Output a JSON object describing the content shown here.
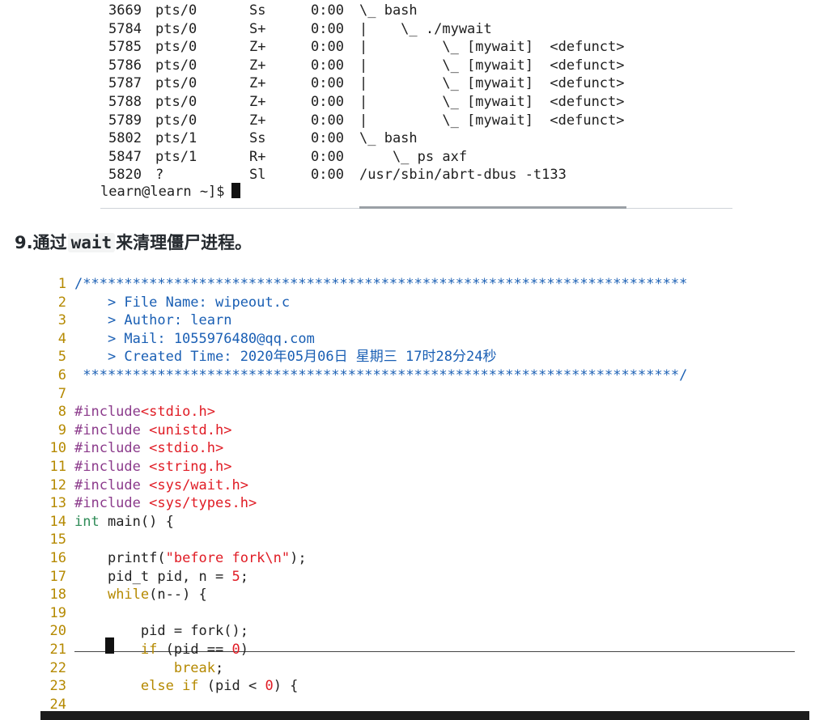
{
  "terminal": {
    "rows": [
      {
        "pid": "3669",
        "tty": "pts/0",
        "stat": "Ss",
        "time": "0:00",
        "cmd": "\\_ bash"
      },
      {
        "pid": "5784",
        "tty": "pts/0",
        "stat": "S+",
        "time": "0:00",
        "cmd": "|    \\_ ./mywait"
      },
      {
        "pid": "5785",
        "tty": "pts/0",
        "stat": "Z+",
        "time": "0:00",
        "cmd": "|         \\_ [mywait]  <defunct>"
      },
      {
        "pid": "5786",
        "tty": "pts/0",
        "stat": "Z+",
        "time": "0:00",
        "cmd": "|         \\_ [mywait]  <defunct>"
      },
      {
        "pid": "5787",
        "tty": "pts/0",
        "stat": "Z+",
        "time": "0:00",
        "cmd": "|         \\_ [mywait]  <defunct>"
      },
      {
        "pid": "5788",
        "tty": "pts/0",
        "stat": "Z+",
        "time": "0:00",
        "cmd": "|         \\_ [mywait]  <defunct>"
      },
      {
        "pid": "5789",
        "tty": "pts/0",
        "stat": "Z+",
        "time": "0:00",
        "cmd": "|         \\_ [mywait]  <defunct>"
      },
      {
        "pid": "5802",
        "tty": "pts/1",
        "stat": "Ss",
        "time": "0:00",
        "cmd": "\\_ bash"
      },
      {
        "pid": "5847",
        "tty": "pts/1",
        "stat": "R+",
        "time": "0:00",
        "cmd": "    \\_ ps axf"
      },
      {
        "pid": "5820",
        "tty": "?",
        "stat": "Sl",
        "time": "0:00",
        "cmd": "/usr/sbin/abrt-dbus -t133"
      }
    ],
    "prompt": "learn@learn ~]$"
  },
  "heading": {
    "prefix": "9.通过",
    "code": "wait",
    "suffix": "来清理僵尸进程。"
  },
  "editor": {
    "lines": [
      {
        "n": "1",
        "parts": [
          {
            "c": "t-comment",
            "t": "/*************************************************************************"
          }
        ]
      },
      {
        "n": "2",
        "parts": [
          {
            "c": "t-comment",
            "t": "    > File Name: wipeout.c"
          }
        ]
      },
      {
        "n": "3",
        "parts": [
          {
            "c": "t-comment",
            "t": "    > Author: learn"
          }
        ]
      },
      {
        "n": "4",
        "parts": [
          {
            "c": "t-comment",
            "t": "    > Mail: 1055976480@qq.com"
          }
        ]
      },
      {
        "n": "5",
        "parts": [
          {
            "c": "t-comment",
            "t": "    > Created Time: 2020年05月06日 星期三 17时28分24秒"
          }
        ]
      },
      {
        "n": "6",
        "parts": [
          {
            "c": "t-comment",
            "t": " ************************************************************************/"
          }
        ]
      },
      {
        "n": "7",
        "parts": []
      },
      {
        "n": "8",
        "parts": [
          {
            "c": "t-pre",
            "t": "#include"
          },
          {
            "c": "t-str",
            "t": "<stdio.h>"
          }
        ]
      },
      {
        "n": "9",
        "parts": [
          {
            "c": "t-pre",
            "t": "#include "
          },
          {
            "c": "t-str",
            "t": "<unistd.h>"
          }
        ]
      },
      {
        "n": "10",
        "parts": [
          {
            "c": "t-pre",
            "t": "#include "
          },
          {
            "c": "t-str",
            "t": "<stdio.h>"
          }
        ]
      },
      {
        "n": "11",
        "parts": [
          {
            "c": "t-pre",
            "t": "#include "
          },
          {
            "c": "t-str",
            "t": "<string.h>"
          }
        ]
      },
      {
        "n": "12",
        "parts": [
          {
            "c": "t-pre",
            "t": "#include "
          },
          {
            "c": "t-str",
            "t": "<sys/wait.h>"
          }
        ]
      },
      {
        "n": "13",
        "parts": [
          {
            "c": "t-pre",
            "t": "#include "
          },
          {
            "c": "t-str",
            "t": "<sys/types.h>"
          }
        ]
      },
      {
        "n": "14",
        "parts": [
          {
            "c": "t-type",
            "t": "int"
          },
          {
            "c": "code",
            "t": " main() {"
          }
        ]
      },
      {
        "n": "15",
        "parts": []
      },
      {
        "n": "16",
        "parts": [
          {
            "c": "code",
            "t": "    printf("
          },
          {
            "c": "t-str",
            "t": "\"before fork\\n\""
          },
          {
            "c": "code",
            "t": ");"
          }
        ]
      },
      {
        "n": "17",
        "parts": [
          {
            "c": "code",
            "t": "    pid_t pid, n = "
          },
          {
            "c": "t-num",
            "t": "5"
          },
          {
            "c": "code",
            "t": ";"
          }
        ]
      },
      {
        "n": "18",
        "parts": [
          {
            "c": "code",
            "t": "    "
          },
          {
            "c": "t-kw",
            "t": "while"
          },
          {
            "c": "code",
            "t": "(n--) {"
          }
        ]
      },
      {
        "n": "19",
        "parts": []
      },
      {
        "n": "20",
        "parts": [
          {
            "c": "code",
            "t": "        pid = fork();"
          }
        ]
      },
      {
        "n": "21",
        "parts": [
          {
            "c": "code",
            "t": "        "
          },
          {
            "c": "t-kw",
            "t": "if"
          },
          {
            "c": "code",
            "t": " (pid == "
          },
          {
            "c": "t-num",
            "t": "0"
          },
          {
            "c": "code",
            "t": ")"
          }
        ]
      },
      {
        "n": "22",
        "parts": [
          {
            "c": "code",
            "t": "            "
          },
          {
            "c": "t-kw",
            "t": "break"
          },
          {
            "c": "code",
            "t": ";"
          }
        ]
      },
      {
        "n": "23",
        "parts": [
          {
            "c": "code",
            "t": "        "
          },
          {
            "c": "t-kw",
            "t": "else if"
          },
          {
            "c": "code",
            "t": " (pid < "
          },
          {
            "c": "t-num",
            "t": "0"
          },
          {
            "c": "code",
            "t": ") {"
          }
        ]
      },
      {
        "n": "24",
        "parts": []
      }
    ]
  }
}
